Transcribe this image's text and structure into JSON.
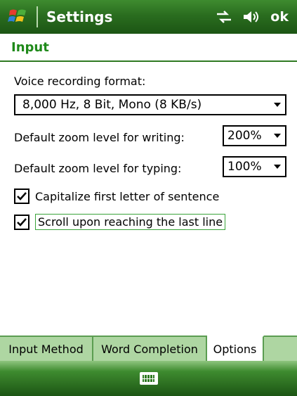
{
  "title_bar": {
    "title": "Settings",
    "ok_label": "ok"
  },
  "page": {
    "title": "Input"
  },
  "voice": {
    "label": "Voice recording format:",
    "value": "8,000 Hz, 8 Bit, Mono (8 KB/s)"
  },
  "zoom_writing": {
    "label": "Default zoom level for writing:",
    "value": "200%"
  },
  "zoom_typing": {
    "label": "Default zoom level for typing:",
    "value": "100%"
  },
  "checkboxes": [
    {
      "label": "Capitalize first letter of sentence",
      "checked": true
    },
    {
      "label": "Scroll upon reaching the last line",
      "checked": true
    }
  ],
  "tabs": [
    {
      "label": "Input Method",
      "active": false
    },
    {
      "label": "Word Completion",
      "active": false
    },
    {
      "label": "Options",
      "active": true
    }
  ],
  "colors": {
    "title_bar": "#2a6d1f",
    "page_title": "#1f8a1a",
    "tab_strip": "#aed6a2"
  },
  "icons": [
    "windows-start-icon",
    "connectivity-icon",
    "speaker-icon",
    "keyboard-icon"
  ]
}
